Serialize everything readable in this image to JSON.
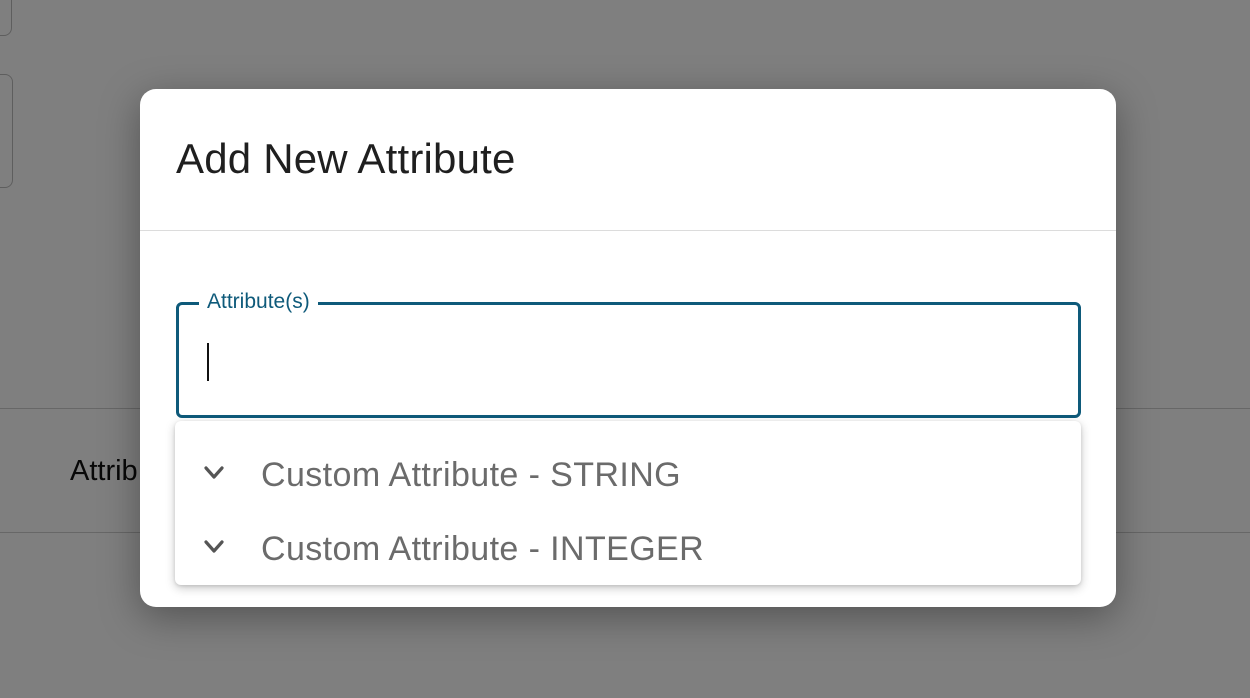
{
  "background": {
    "row_label": "Attrib"
  },
  "dialog": {
    "title": "Add New Attribute",
    "field": {
      "label": "Attribute(s)",
      "value": "",
      "placeholder": ""
    },
    "dropdown": {
      "options": [
        {
          "label": "Custom Attribute - STRING",
          "icon": "chevron-down-icon"
        },
        {
          "label": "Custom Attribute - INTEGER",
          "icon": "chevron-down-icon"
        }
      ]
    }
  },
  "colors": {
    "accent": "#0e5a7a",
    "overlay": "rgba(0,0,0,0.5)",
    "option_text": "#6b6b6b"
  }
}
